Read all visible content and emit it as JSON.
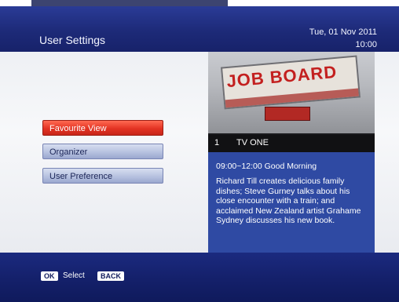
{
  "header": {
    "title": "User Settings",
    "date": "Tue, 01 Nov 2011",
    "time": "10:00"
  },
  "menu": {
    "items": [
      {
        "label": "Favourite View",
        "selected": true
      },
      {
        "label": "Organizer",
        "selected": false
      },
      {
        "label": "User Preference",
        "selected": false
      }
    ]
  },
  "preview": {
    "board_text": "JOB BOARD",
    "channel_number": "1",
    "channel_name": "TV ONE"
  },
  "program": {
    "time_title": "09:00~12:00  Good Morning",
    "description": "Richard Till creates delicious family dishes; Steve Gurney talks about his close encounter with a train; and acclaimed New Zealand artist Grahame Sydney discusses his new book."
  },
  "footer": {
    "ok_key": "OK",
    "select_label": "Select",
    "back_key": "BACK"
  },
  "colors": {
    "header_blue": "#1d2a78",
    "selected_red": "#e33323",
    "info_blue": "#2f4aa3"
  }
}
